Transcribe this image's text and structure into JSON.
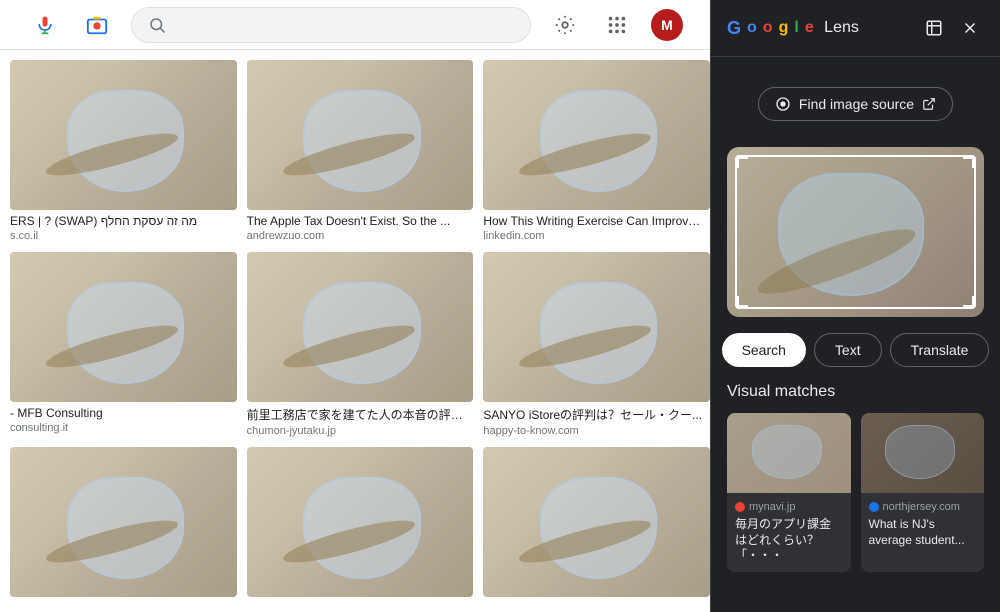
{
  "topbar": {
    "avatar_initial": "M",
    "search_placeholder": "Search"
  },
  "lens": {
    "title": "Google Lens",
    "google_text": "Google",
    "lens_text": "Lens",
    "find_source_label": "Find image source",
    "external_icon": "↗",
    "close_icon": "✕",
    "open_new_icon": "⧉",
    "action_buttons": {
      "search": "Search",
      "text": "Text",
      "translate": "Translate"
    },
    "visual_matches_title": "Visual matches",
    "matches": [
      {
        "source": "mynavi.jp",
        "dot_color": "red",
        "description": "毎月のアプリ課金はどれくらい？「・・・"
      },
      {
        "source": "northjersey.com",
        "dot_color": "blue",
        "description": "What is NJ's average student..."
      }
    ]
  },
  "grid": {
    "rows": [
      [
        {
          "title": "ERS | ? (SWAP) מה זה עסקת החלף",
          "source": "s.co.il"
        },
        {
          "title": "The Apple Tax Doesn't Exist. So the ...",
          "source": "andrewzuo.com"
        },
        {
          "title": "How This Writing Exercise Can Improve ...",
          "source": "linkedin.com"
        }
      ],
      [
        {
          "title": "- MFB Consulting",
          "source": "consulting.it"
        },
        {
          "title": "前里工務店で家を建てた人の本音の評判・...",
          "source": "chumon-jyutaku.jp"
        },
        {
          "title": "SANYO iStoreの評判は？セール・クー...",
          "source": "happy-to-know.com"
        }
      ],
      [
        {
          "title": "",
          "source": ""
        },
        {
          "title": "",
          "source": ""
        },
        {
          "title": "",
          "source": ""
        }
      ]
    ]
  }
}
